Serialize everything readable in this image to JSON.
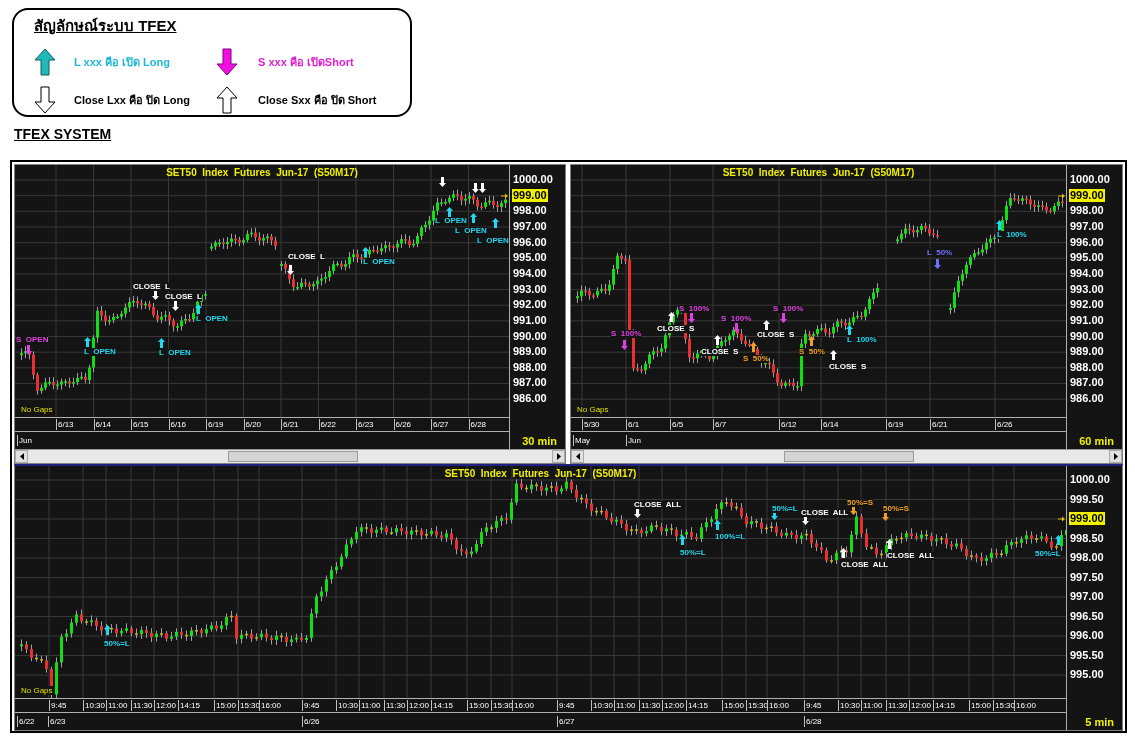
{
  "legend": {
    "title": "สัญลักษณ์ระบบ TFEX",
    "items": [
      {
        "kind": "open_long",
        "text": "L xxx คือ เปิด Long"
      },
      {
        "kind": "open_short",
        "text": "S xxx คือ เปิดShort"
      },
      {
        "kind": "close_long",
        "text": "Close Lxx คือ ปิด Long"
      },
      {
        "kind": "close_short",
        "text": "Close Sxx คือ ปิด Short"
      }
    ]
  },
  "section_title": "TFEX SYSTEM",
  "charts": [
    {
      "title": "SET50  Index  Futures  Jun-17  (S50M17)",
      "note": "No Gaps",
      "interval": "30 min",
      "price_labels": [
        {
          "text": "1000.00",
          "highlighted": false
        },
        {
          "text": "999.00",
          "highlighted": true
        },
        {
          "text": "998.00",
          "highlighted": false
        },
        {
          "text": "997.00",
          "highlighted": false
        },
        {
          "text": "996.00",
          "highlighted": false
        },
        {
          "text": "995.00",
          "highlighted": false
        },
        {
          "text": "994.00",
          "highlighted": false
        },
        {
          "text": "993.00",
          "highlighted": false
        },
        {
          "text": "992.00",
          "highlighted": false
        },
        {
          "text": "991.00",
          "highlighted": false
        },
        {
          "text": "990.00",
          "highlighted": false
        },
        {
          "text": "989.00",
          "highlighted": false
        },
        {
          "text": "988.00",
          "highlighted": false
        },
        {
          "text": "987.00",
          "highlighted": false
        },
        {
          "text": "986.00",
          "highlighted": false
        }
      ],
      "time_labels": [
        "6/13",
        "6/14",
        "6/15",
        "6/16",
        "6/19",
        "6/20",
        "6/21",
        "6/22",
        "6/23",
        "6/26",
        "6/27",
        "6/28"
      ],
      "period_labels": [
        "Jun"
      ],
      "signals": [
        {
          "arrow_up": false,
          "color": "#ffffff"
        },
        {
          "arrow_up": false,
          "color": "#ffffff"
        },
        {
          "arrow_up": false,
          "color": "#ffffff"
        },
        {
          "text": "L  OPEN",
          "arrow_up": true,
          "color": "#20d8f0"
        },
        {
          "text": "L  OPEN",
          "arrow_up": true,
          "color": "#20d8f0"
        },
        {
          "text": "L  OPEN",
          "arrow_up": true,
          "color": "#20d8f0"
        },
        {
          "text": "L  OPEN",
          "arrow_up": true,
          "color": "#20d8f0"
        },
        {
          "text": "CLOSE  L",
          "arrow_up": false,
          "color": "#ffffff"
        },
        {
          "text": "CLOSE  L",
          "arrow_up": false,
          "color": "#ffffff"
        },
        {
          "text": "CLOSE  L",
          "arrow_up": false,
          "color": "#ffffff"
        },
        {
          "text": "L  OPEN",
          "arrow_up": true,
          "color": "#20d8f0"
        },
        {
          "text": "S  OPEN",
          "arrow_up": false,
          "color": "#e040e0"
        },
        {
          "text": "L  OPEN",
          "arrow_up": true,
          "color": "#20d8f0"
        },
        {
          "text": "L  OPEN",
          "arrow_up": true,
          "color": "#20d8f0"
        }
      ]
    },
    {
      "title": "SET50  Index  Futures  Jun-17  (S50M17)",
      "note": "No Gaps",
      "interval": "60 min",
      "price_labels": [
        {
          "text": "1000.00",
          "highlighted": false
        },
        {
          "text": "999.00",
          "highlighted": true
        },
        {
          "text": "998.00",
          "highlighted": false
        },
        {
          "text": "997.00",
          "highlighted": false
        },
        {
          "text": "996.00",
          "highlighted": false
        },
        {
          "text": "995.00",
          "highlighted": false
        },
        {
          "text": "994.00",
          "highlighted": false
        },
        {
          "text": "993.00",
          "highlighted": false
        },
        {
          "text": "992.00",
          "highlighted": false
        },
        {
          "text": "991.00",
          "highlighted": false
        },
        {
          "text": "990.00",
          "highlighted": false
        },
        {
          "text": "989.00",
          "highlighted": false
        },
        {
          "text": "988.00",
          "highlighted": false
        },
        {
          "text": "987.00",
          "highlighted": false
        },
        {
          "text": "986.00",
          "highlighted": false
        }
      ],
      "time_labels": [
        "5/30",
        "6/1",
        "6/5",
        "6/7",
        "6/12",
        "6/14",
        "6/19",
        "6/21",
        "6/26"
      ],
      "period_labels": [
        "May",
        "Jun"
      ],
      "signals": [
        {
          "text": "L  100%",
          "arrow_up": true,
          "color": "#20d8f0"
        },
        {
          "text": "L  50%",
          "arrow_up": false,
          "color": "#7070ff"
        },
        {
          "text": "S  100%",
          "arrow_up": false,
          "color": "#e040e0"
        },
        {
          "text": "S  100%",
          "arrow_up": false,
          "color": "#e040e0"
        },
        {
          "text": "CLOSE  S",
          "arrow_up": true,
          "color": "#ffffff"
        },
        {
          "text": "S  100%",
          "arrow_up": false,
          "color": "#e040e0"
        },
        {
          "text": "CLOSE  S",
          "arrow_up": true,
          "color": "#ffffff"
        },
        {
          "text": "L  100%",
          "arrow_up": true,
          "color": "#20d8f0"
        },
        {
          "text": "S  100%",
          "arrow_up": false,
          "color": "#e040e0"
        },
        {
          "text": "CLOSE  S",
          "arrow_up": true,
          "color": "#ffffff"
        },
        {
          "text": "S  50%",
          "arrow_up": true,
          "color": "#f0a020"
        },
        {
          "text": "S  50%",
          "arrow_up": true,
          "color": "#f0a020"
        },
        {
          "text": "CLOSE  S",
          "arrow_up": true,
          "color": "#ffffff"
        }
      ]
    },
    {
      "title": "SET50  Index  Futures  Jun-17  (S50M17)",
      "note": "No Gaps",
      "interval": "5 min",
      "price_labels": [
        {
          "text": "1000.00",
          "highlighted": false
        },
        {
          "text": "999.50",
          "highlighted": false
        },
        {
          "text": "999.00",
          "highlighted": true
        },
        {
          "text": "998.50",
          "highlighted": false
        },
        {
          "text": "998.00",
          "highlighted": false
        },
        {
          "text": "997.50",
          "highlighted": false
        },
        {
          "text": "997.00",
          "highlighted": false
        },
        {
          "text": "996.50",
          "highlighted": false
        },
        {
          "text": "996.00",
          "highlighted": false
        },
        {
          "text": "995.50",
          "highlighted": false
        },
        {
          "text": "995.00",
          "highlighted": false
        }
      ],
      "time_labels": [
        "9:45",
        "10:30",
        "11:00",
        "11:30",
        "12:00",
        "14:15",
        "15:00",
        "15:30",
        "16:00",
        "9:45",
        "10:30",
        "11:00",
        "11:30",
        "12:00",
        "14:15",
        "15:00",
        "15:30",
        "16:00",
        "9:45",
        "10:30",
        "11:00",
        "11:30",
        "12:00",
        "14:15",
        "15:00",
        "15:30",
        "16:00",
        "9:45",
        "10:30",
        "11:00",
        "11:30",
        "12:00",
        "14:15",
        "15:00",
        "15:30",
        "16:00"
      ],
      "period_labels": [
        "6/22",
        "6/23",
        "6/26",
        "6/27",
        "6/28"
      ],
      "signals": [
        {
          "text": "50%=S",
          "arrow_up": false,
          "color": "#f0a020"
        },
        {
          "text": "CLOSE  ALL",
          "arrow_up": false,
          "color": "#ffffff"
        },
        {
          "text": "50%=L",
          "arrow_up": false,
          "color": "#20d8f0"
        },
        {
          "text": "50%=S",
          "arrow_up": false,
          "color": "#f0a020"
        },
        {
          "text": "CLOSE  ALL",
          "arrow_up": false,
          "color": "#ffffff"
        },
        {
          "text": "100%=L",
          "arrow_up": true,
          "color": "#20d8f0"
        },
        {
          "text": "50%=L",
          "arrow_up": true,
          "color": "#20d8f0"
        },
        {
          "text": "50%=L",
          "arrow_up": true,
          "color": "#20d8f0"
        },
        {
          "text": "CLOSE  ALL",
          "arrow_up": true,
          "color": "#ffffff"
        },
        {
          "text": "CLOSE  ALL",
          "arrow_up": true,
          "color": "#ffffff"
        },
        {
          "text": "50%=L",
          "arrow_up": true,
          "color": "#20d8f0"
        }
      ]
    }
  ]
}
